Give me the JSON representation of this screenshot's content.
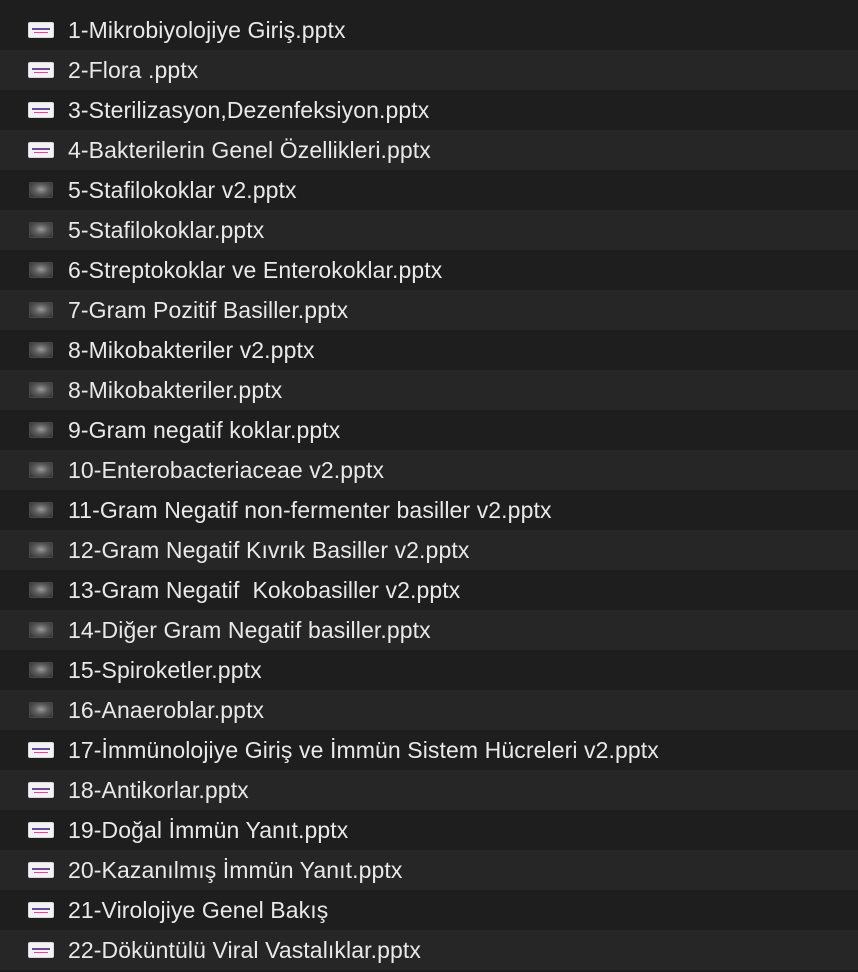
{
  "files": [
    {
      "name": "1-Mikrobiyolojiye Giriş.pptx",
      "icon": "title-slide"
    },
    {
      "name": "2-Flora .pptx",
      "icon": "title-slide"
    },
    {
      "name": "3-Sterilizasyon,Dezenfeksiyon.pptx",
      "icon": "title-slide"
    },
    {
      "name": "4-Bakterilerin Genel Özellikleri.pptx",
      "icon": "title-slide"
    },
    {
      "name": "5-Stafilokoklar v2.pptx",
      "icon": "photo-slide"
    },
    {
      "name": "5-Stafilokoklar.pptx",
      "icon": "photo-slide"
    },
    {
      "name": "6-Streptokoklar ve Enterokoklar.pptx",
      "icon": "photo-slide"
    },
    {
      "name": "7-Gram Pozitif Basiller.pptx",
      "icon": "photo-slide"
    },
    {
      "name": "8-Mikobakteriler v2.pptx",
      "icon": "photo-slide"
    },
    {
      "name": "8-Mikobakteriler.pptx",
      "icon": "photo-slide"
    },
    {
      "name": "9-Gram negatif koklar.pptx",
      "icon": "photo-slide"
    },
    {
      "name": "10-Enterobacteriaceae v2.pptx",
      "icon": "photo-slide"
    },
    {
      "name": "11-Gram Negatif non-fermenter basiller v2.pptx",
      "icon": "photo-slide"
    },
    {
      "name": "12-Gram Negatif Kıvrık Basiller v2.pptx",
      "icon": "photo-slide"
    },
    {
      "name": "13-Gram Negatif  Kokobasiller v2.pptx",
      "icon": "photo-slide"
    },
    {
      "name": "14-Diğer Gram Negatif basiller.pptx",
      "icon": "photo-slide"
    },
    {
      "name": "15-Spiroketler.pptx",
      "icon": "photo-slide"
    },
    {
      "name": "16-Anaeroblar.pptx",
      "icon": "photo-slide"
    },
    {
      "name": "17-İmmünolojiye Giriş ve İmmün Sistem Hücreleri v2.pptx",
      "icon": "title-slide"
    },
    {
      "name": "18-Antikorlar.pptx",
      "icon": "title-slide"
    },
    {
      "name": "19-Doğal İmmün Yanıt.pptx",
      "icon": "title-slide"
    },
    {
      "name": "20-Kazanılmış İmmün Yanıt.pptx",
      "icon": "title-slide"
    },
    {
      "name": "21-Virolojiye Genel Bakış",
      "icon": "title-slide"
    },
    {
      "name": "22-Döküntülü Viral Vastalıklar.pptx",
      "icon": "title-slide"
    }
  ]
}
